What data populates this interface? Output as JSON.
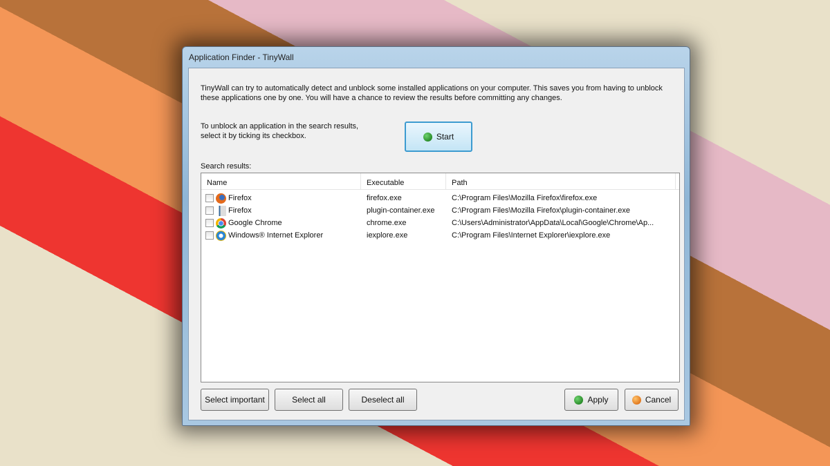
{
  "window": {
    "title": "Application Finder - TinyWall"
  },
  "intro": "TinyWall can try to automatically detect and unblock some installed applications on your computer. This saves you from having to unblock these applications one by one. You will have a chance to review the results before committing any changes.",
  "hint": [
    "To unblock an application in the search results,",
    "select it by ticking its checkbox."
  ],
  "start_label": "Start",
  "search_results_label": "Search results:",
  "columns": [
    "Name",
    "Executable",
    "Path"
  ],
  "rows": [
    {
      "name": "Firefox",
      "exe": "firefox.exe",
      "path": "C:\\Program Files\\Mozilla Firefox\\firefox.exe",
      "icon": "firefox-icon",
      "checked": false
    },
    {
      "name": "Firefox",
      "exe": "plugin-container.exe",
      "path": "C:\\Program Files\\Mozilla Firefox\\plugin-container.exe",
      "icon": "plugin-container-icon",
      "checked": false
    },
    {
      "name": "Google Chrome",
      "exe": "chrome.exe",
      "path": "C:\\Users\\Administrator\\AppData\\Local\\Google\\Chrome\\Ap...",
      "icon": "chrome-icon",
      "checked": false
    },
    {
      "name": "Windows® Internet Explorer",
      "exe": "iexplore.exe",
      "path": "C:\\Program Files\\Internet Explorer\\iexplore.exe",
      "icon": "ie-icon",
      "checked": false
    }
  ],
  "buttons": {
    "select_important": "Select important",
    "select_all": "Select all",
    "deselect_all": "Deselect all",
    "apply": "Apply",
    "cancel": "Cancel"
  }
}
